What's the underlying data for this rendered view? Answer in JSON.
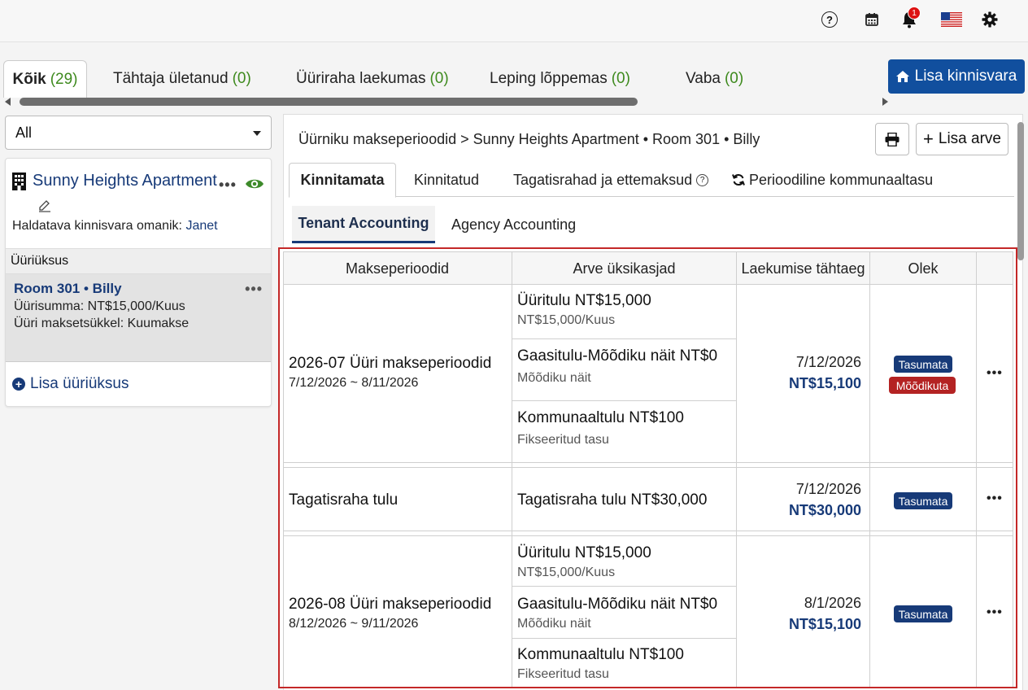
{
  "topbar": {
    "icons": [
      "help-icon",
      "calendar-icon",
      "bell-icon",
      "us-flag-icon",
      "gear-icon"
    ],
    "help_symbol": "?",
    "notification_count": "1"
  },
  "main_tabs": [
    {
      "label": "Kõik",
      "count": "(29)"
    },
    {
      "label": "Tähtaja ületanud",
      "count": "(0)"
    },
    {
      "label": "Üüriraha laekumas",
      "count": "(0)"
    },
    {
      "label": "Leping lõppemas",
      "count": "(0)"
    },
    {
      "label": "Vaba",
      "count": "(0)"
    }
  ],
  "add_property_label": "Lisa kinnisvara",
  "filter": {
    "selected": "All"
  },
  "property": {
    "name": "Sunny Heights Apartment",
    "owner_prefix": "Haldatava kinnisvara omanik:",
    "owner_name": "Janet"
  },
  "units": {
    "header": "Üüriüksus",
    "items": [
      {
        "room": "Room 301",
        "sep": "•",
        "tenant": "Billy",
        "rent": "Üürisumma: NT$15,000/Kuus",
        "cycle": "Üüri maksetsükkel: Kuumakse"
      }
    ],
    "add_label": "Lisa üüriüksus"
  },
  "breadcrumb": "Üürniku makseperioodid > Sunny Heights Apartment • Room 301 • Billy",
  "add_bill_label": "Lisa arve",
  "tabs2": [
    "Kinnitamata",
    "Kinnitatud",
    "Tagatisrahad ja ettemaksud",
    "Perioodiline kommunaaltasu"
  ],
  "tabs3": [
    "Tenant Accounting",
    "Agency Accounting"
  ],
  "table": {
    "headers": [
      "Makseperioodid",
      "Arve üksikasjad",
      "Laekumise tähtaeg",
      "Olek"
    ],
    "rows": [
      {
        "period": "2026-07 Üüri makseperioodid",
        "range": "7/12/2026 ~ 8/11/2026",
        "items": [
          {
            "title": "Üüritulu NT$15,000",
            "sub": "NT$15,000/Kuus"
          },
          {
            "title": "Gaasitulu-Mõõdiku näit NT$0",
            "sub": "Mõõdiku näit"
          },
          {
            "title": "Kommunaaltulu NT$100",
            "sub": "Fikseeritud tasu"
          }
        ],
        "due_date": "7/12/2026",
        "due_amount": "NT$15,100",
        "statuses": [
          "Tasumata",
          "Mõõdikuta"
        ]
      },
      {
        "period": "Tagatisraha tulu",
        "items": [
          {
            "title": "Tagatisraha tulu NT$30,000"
          }
        ],
        "due_date": "7/12/2026",
        "due_amount": "NT$30,000",
        "statuses": [
          "Tasumata"
        ]
      },
      {
        "period": "2026-08 Üüri makseperioodid",
        "range": "8/12/2026 ~ 9/11/2026",
        "items": [
          {
            "title": "Üüritulu NT$15,000",
            "sub": "NT$15,000/Kuus"
          },
          {
            "title": "Gaasitulu-Mõõdiku näit NT$0",
            "sub": "Mõõdiku näit"
          },
          {
            "title": "Kommunaaltulu NT$100",
            "sub": "Fikseeritud tasu"
          }
        ],
        "due_date": "8/1/2026",
        "due_amount": "NT$15,100",
        "statuses": [
          "Tasumata"
        ]
      }
    ]
  },
  "colors": {
    "brand": "#114f9e",
    "accent_dark": "#173a78",
    "count_green": "#3e8a1e",
    "alert_red": "#b42323",
    "highlight_border": "#c42828"
  }
}
